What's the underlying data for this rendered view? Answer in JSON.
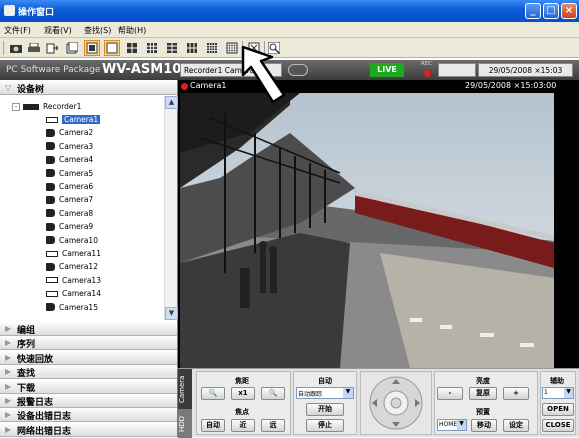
{
  "window": {
    "title": "操作窗口"
  },
  "menu": [
    "文件(F)",
    "观看(V)",
    "查找(S)",
    "帮助(H)"
  ],
  "header": {
    "package": "PC Software Package",
    "model": "WV-ASM100",
    "recorder": "Recorder1 Camera1",
    "live": "LIVE",
    "rec": "REC",
    "datetime": "29/05/2008 ×15:03"
  },
  "sidebar": {
    "device_tree": "设备树",
    "root": "Recorder1",
    "cameras": [
      "Camera1",
      "Camera2",
      "Camera3",
      "Camera4",
      "Camera5",
      "Camera6",
      "Camera7",
      "Camera8",
      "Camera9",
      "Camera10",
      "Camera11",
      "Camera12",
      "Camera13",
      "Camera14",
      "Camera15"
    ],
    "sections": [
      "编组",
      "序列",
      "快速回放",
      "查找",
      "下载",
      "报警日志",
      "设备出错日志",
      "网络出错日志"
    ]
  },
  "viewer": {
    "camera": "Camera1",
    "datetime": "29/05/2008 ×15:03:00"
  },
  "ptz": {
    "tab": "Camera",
    "tab2": "HDD",
    "zoom": "焦距",
    "x1": "x1",
    "focus": "焦点",
    "auto_btn": "自动",
    "near": "近",
    "far": "远",
    "auto_label": "自动",
    "auto_mode": "自动跟踪",
    "start": "开始",
    "stop": "停止",
    "brightness": "亮度",
    "minus": "-",
    "reset": "复原",
    "plus": "+",
    "preset": "预置",
    "home": "HOME",
    "move": "移动",
    "set": "设定",
    "aux": "辅助",
    "aux_val": "1",
    "open": "OPEN",
    "close": "CLOSE"
  }
}
